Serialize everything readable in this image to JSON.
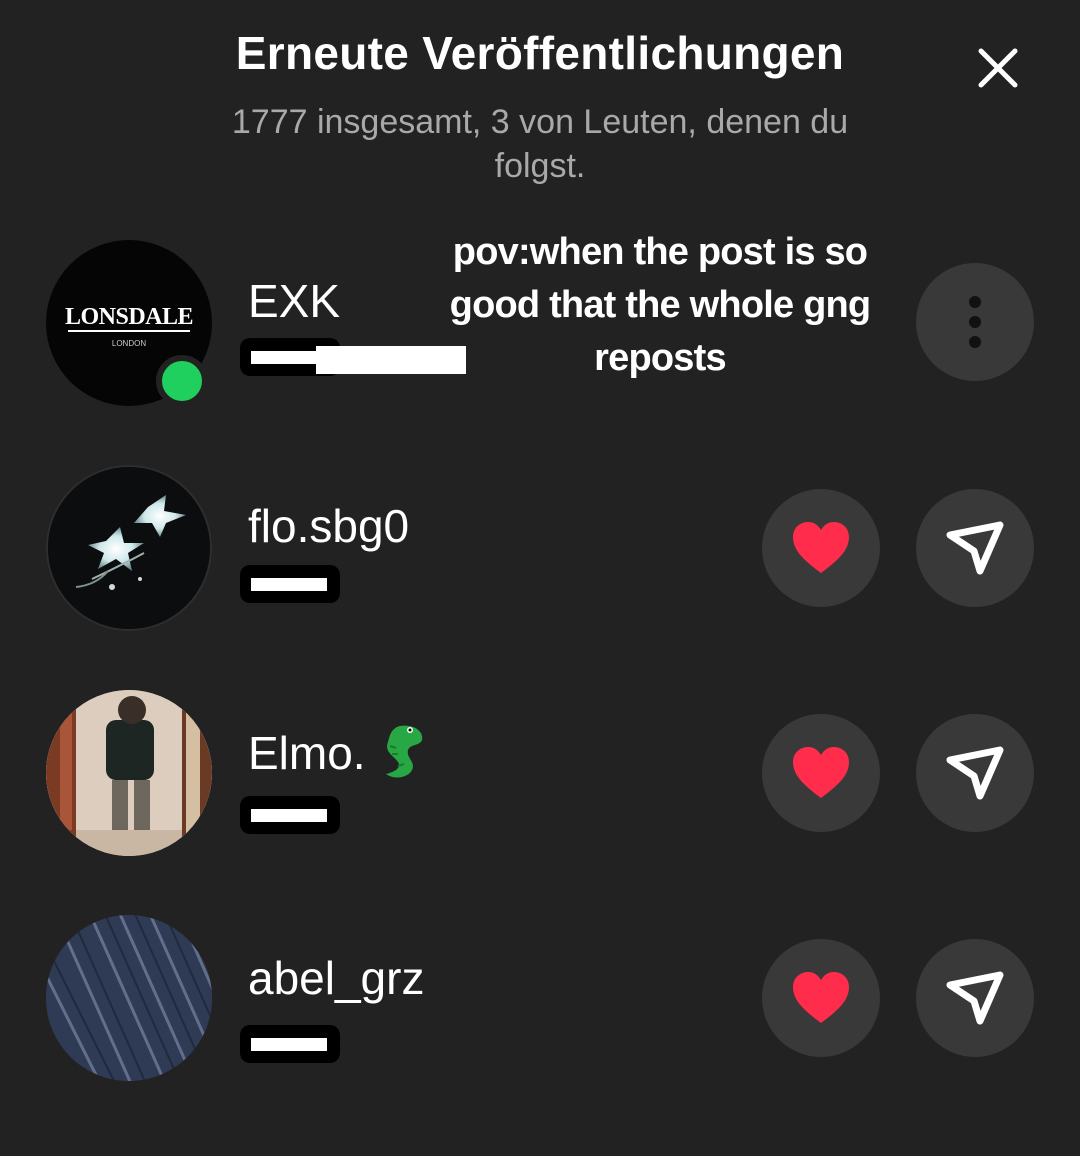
{
  "header": {
    "title": "Erneute Veröffentlichungen",
    "subtitle": "1777 insgesamt, 3 von Leuten, denen du folgst."
  },
  "overlay": {
    "caption": "pov:when the post is so good that the whole gng reposts"
  },
  "users": [
    {
      "username": "EXK",
      "avatar_logo": "LONSDALE",
      "avatar_logo_sub": "LONDON",
      "online": true,
      "action": "more-options"
    },
    {
      "username": "flo.sbg0",
      "action": "like-and-send"
    },
    {
      "username": "Elmo.",
      "emoji": "crocodile",
      "action": "like-and-send"
    },
    {
      "username": "abel_grz",
      "action": "like-and-send"
    }
  ],
  "colors": {
    "background": "#222222",
    "button": "#393939",
    "online": "#20d05e",
    "heart": "#ff2d4b",
    "subtitle": "#a9a9a9"
  },
  "icons": [
    "close-icon",
    "more-vertical-icon",
    "heart-icon",
    "send-icon"
  ]
}
